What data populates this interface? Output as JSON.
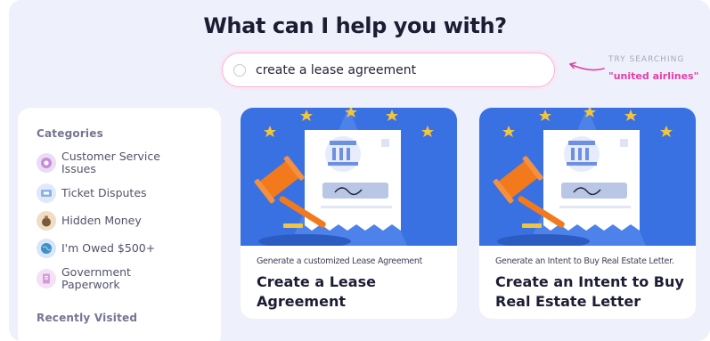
{
  "headline": "What can I help you with?",
  "search": {
    "value": "create a lease agreement"
  },
  "try_searching": {
    "label": "TRY SEARCHING",
    "value": "\"united airlines\""
  },
  "sidebar": {
    "categories_heading": "Categories",
    "categories": [
      {
        "label": "Customer Service Issues",
        "icon": "support-icon",
        "color": "#c98ad8"
      },
      {
        "label": "Ticket Disputes",
        "icon": "ticket-icon",
        "color": "#8fb0e6"
      },
      {
        "label": "Hidden Money",
        "icon": "money-bag-icon",
        "color": "#7a5a3a"
      },
      {
        "label": "I'm Owed $500+",
        "icon": "globe-icon",
        "color": "#3f8bd6"
      },
      {
        "label": "Government Paperwork",
        "icon": "document-icon",
        "color": "#d79adf"
      }
    ],
    "recent_heading": "Recently Visited"
  },
  "cards": [
    {
      "subtitle": "Generate a customized Lease Agreement",
      "title": "Create a Lease Agreement",
      "illustration": "gavel-document-icon",
      "bg_color": "#3a71e2"
    },
    {
      "subtitle": "Generate an Intent to Buy Real Estate Letter.",
      "title": "Create an Intent to Buy Real Estate Letter",
      "illustration": "gavel-document-icon",
      "bg_color": "#3a71e2"
    }
  ],
  "colors": {
    "accent_pink": "#e23fa8",
    "background": "#eef0fb",
    "title": "#1c1d33",
    "card_blue": "#3a71e2",
    "gavel": "#f27a1c",
    "star": "#f2c53d"
  }
}
